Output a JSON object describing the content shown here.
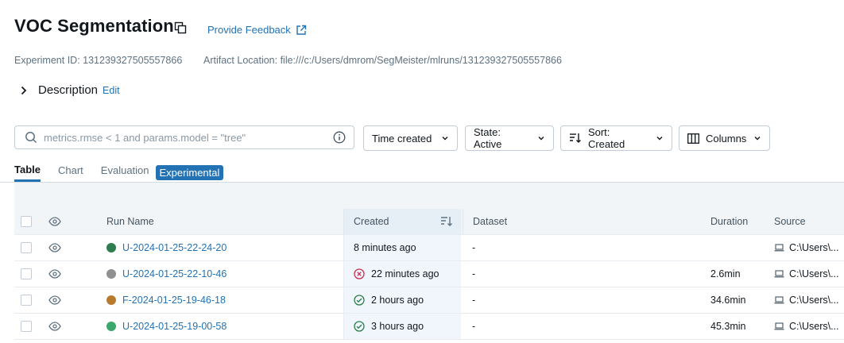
{
  "header": {
    "title": "VOC Segmentation",
    "feedback_label": "Provide Feedback",
    "experiment_id": "Experiment ID: 131239327505557866",
    "artifact_location": "Artifact Location: file:///c:/Users/dmrom/SegMeister/mlruns/131239327505557866"
  },
  "description": {
    "label": "Description",
    "edit_label": "Edit"
  },
  "search": {
    "placeholder": "metrics.rmse < 1 and params.model = \"tree\""
  },
  "filters": {
    "time_created": "Time created",
    "state": "State: Active",
    "sort": "Sort: Created",
    "columns": "Columns"
  },
  "tabs": [
    {
      "label": "Table",
      "active": true
    },
    {
      "label": "Chart",
      "active": false
    },
    {
      "label": "Evaluation",
      "active": false
    }
  ],
  "experimental_badge": "Experimental",
  "table": {
    "columns": {
      "run_name": "Run Name",
      "created": "Created",
      "dataset": "Dataset",
      "duration": "Duration",
      "source": "Source"
    },
    "rows": [
      {
        "name": "U-2024-01-25-22-24-20",
        "color": "#2e7d4f",
        "status": "none",
        "created": "8 minutes ago",
        "dataset": "-",
        "duration": "",
        "source": "C:\\Users\\..."
      },
      {
        "name": "U-2024-01-25-22-10-46",
        "color": "#909090",
        "status": "failed",
        "created": "22 minutes ago",
        "dataset": "-",
        "duration": "2.6min",
        "source": "C:\\Users\\..."
      },
      {
        "name": "F-2024-01-25-19-46-18",
        "color": "#b87a2c",
        "status": "finished",
        "created": "2 hours ago",
        "dataset": "-",
        "duration": "34.6min",
        "source": "C:\\Users\\..."
      },
      {
        "name": "U-2024-01-25-19-00-58",
        "color": "#3aa76d",
        "status": "finished",
        "created": "3 hours ago",
        "dataset": "-",
        "duration": "45.3min",
        "source": "C:\\Users\\..."
      }
    ]
  },
  "colors": {
    "accent": "#2272b4",
    "failed": "#c82d4c",
    "finished": "#277c43"
  }
}
